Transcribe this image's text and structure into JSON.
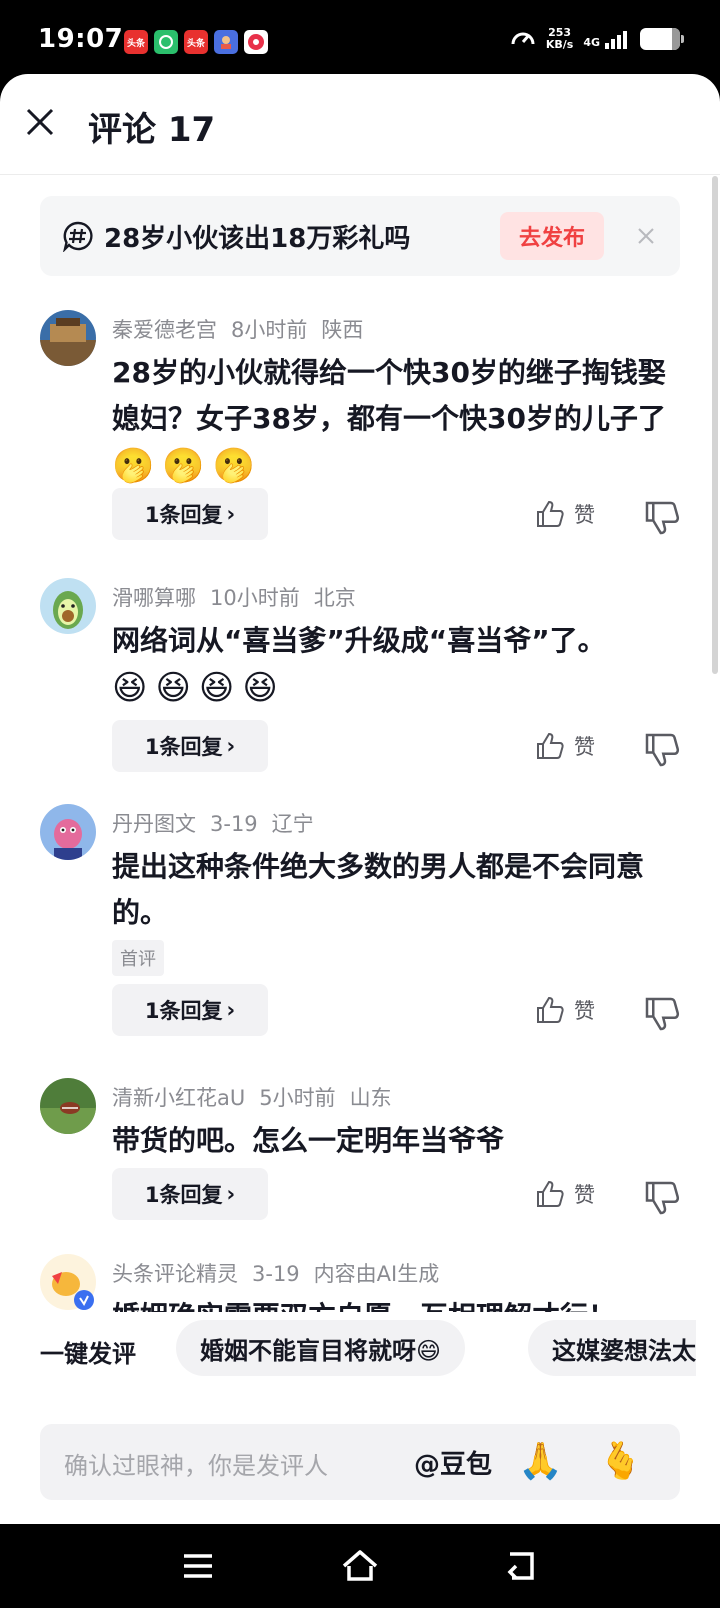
{
  "status_bar": {
    "time": "19:07",
    "speed_value": "253",
    "speed_unit": "KB/s",
    "network": "4G",
    "apps": [
      {
        "label": "头条",
        "color": "#e8312f"
      },
      {
        "label": "",
        "color": "#2bbf6c"
      },
      {
        "label": "头条",
        "color": "#e8312f"
      },
      {
        "label": "",
        "color": "#4a6fe0"
      },
      {
        "label": "",
        "color": "#e8314a"
      }
    ]
  },
  "header": {
    "title": "评论 17"
  },
  "topic": {
    "text": "28岁小伙该出18万彩礼吗",
    "button": "去发布"
  },
  "comments": [
    {
      "user": "秦爱德老宫",
      "time": "8小时前",
      "location": "陕西",
      "text": "28岁的小伙就得给一个快30岁的继子掏钱娶媳妇？女子38岁，都有一个快30岁的儿子了",
      "emojis": [
        "🫢",
        "🫢",
        "🫢"
      ],
      "reply_label": "1条回复",
      "like_label": "赞"
    },
    {
      "user": "滑哪算哪",
      "time": "10小时前",
      "location": "北京",
      "text": "网络词从“喜当爹”升级成“喜当爷”了。",
      "emojis": [
        "😆",
        "😆",
        "😆",
        "😆"
      ],
      "reply_label": "1条回复",
      "like_label": "赞"
    },
    {
      "user": "丹丹图文",
      "time": "3-19",
      "location": "辽宁",
      "text": "提出这种条件绝大多数的男人都是不会同意的。",
      "tag": "首评",
      "reply_label": "1条回复",
      "like_label": "赞"
    },
    {
      "user": "清新小红花aU",
      "time": "5小时前",
      "location": "山东",
      "text": "带货的吧。怎么一定明年当爷爷",
      "reply_label": "1条回复",
      "like_label": "赞"
    },
    {
      "user": "头条评论精灵",
      "time": "3-19",
      "location": "内容由AI生成",
      "text": "婚姻确实需要双方自愿，互相理解才行！"
    }
  ],
  "quick_comment": {
    "label": "一键发评",
    "chips": [
      "婚姻不能盲目将就呀😄",
      "这媒婆想法太"
    ]
  },
  "input": {
    "placeholder": "确认过眼神，你是发评人",
    "mention": "@豆包",
    "emoji_1": "🙏",
    "emoji_2": "🫰"
  }
}
